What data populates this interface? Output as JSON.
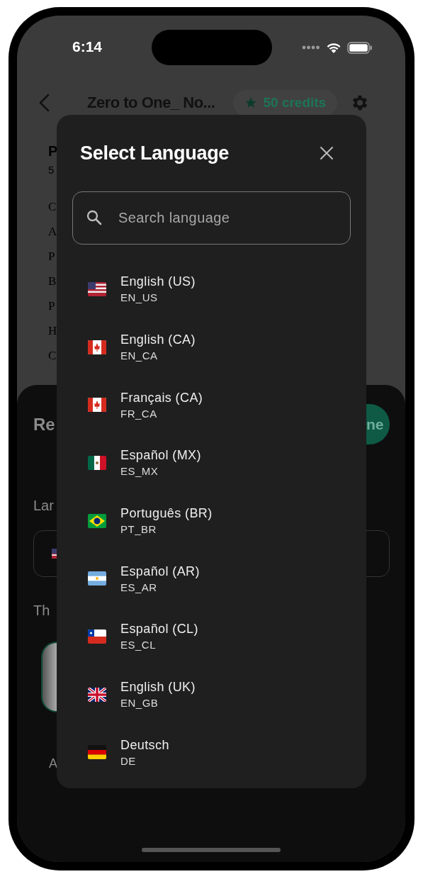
{
  "status_bar": {
    "time": "6:14"
  },
  "header": {
    "title": "Zero to One_ No...",
    "credits": "50 credits"
  },
  "background_text": {
    "heading": "P",
    "subtitle": "5",
    "lines": [
      "C",
      "A",
      "P",
      "B",
      "P",
      "H",
      "C"
    ]
  },
  "sheet": {
    "title": "Re",
    "done_button": "ne",
    "language_label": "Lar",
    "theme_label": "Th",
    "theme_option": "A"
  },
  "modal": {
    "title": "Select Language",
    "search": {
      "placeholder": "Search language"
    },
    "languages": [
      {
        "name": "English (US)",
        "code": "EN_US",
        "kind": "us"
      },
      {
        "name": "English (CA)",
        "code": "EN_CA",
        "kind": "ca"
      },
      {
        "name": "Français (CA)",
        "code": "FR_CA",
        "kind": "ca"
      },
      {
        "name": "Español (MX)",
        "code": "ES_MX",
        "kind": "mx"
      },
      {
        "name": "Português (BR)",
        "code": "PT_BR",
        "kind": "br"
      },
      {
        "name": "Español (AR)",
        "code": "ES_AR",
        "kind": "ar"
      },
      {
        "name": "Español (CL)",
        "code": "ES_CL",
        "kind": "cl"
      },
      {
        "name": "English (UK)",
        "code": "EN_GB",
        "kind": "gb"
      },
      {
        "name": "Deutsch",
        "code": "DE",
        "kind": "de"
      }
    ]
  }
}
